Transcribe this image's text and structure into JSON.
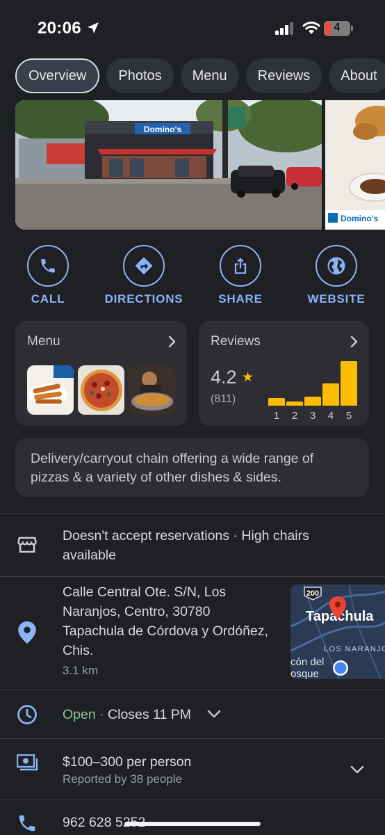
{
  "status_bar": {
    "time": "20:06",
    "battery_level": "4"
  },
  "tabs": [
    {
      "label": "Overview",
      "active": true
    },
    {
      "label": "Photos",
      "active": false
    },
    {
      "label": "Menu",
      "active": false
    },
    {
      "label": "Reviews",
      "active": false
    },
    {
      "label": "About",
      "active": false
    }
  ],
  "photos": {
    "main_sign_text": "Domino's",
    "second_sign_text": "Domino's"
  },
  "actions": {
    "call": "CALL",
    "directions": "DIRECTIONS",
    "share": "SHARE",
    "website": "WEBSITE"
  },
  "menu_card": {
    "title": "Menu"
  },
  "reviews_card": {
    "title": "Reviews",
    "rating": "4.2",
    "count": "(811)",
    "histogram_labels": [
      "1",
      "2",
      "3",
      "4",
      "5"
    ],
    "histogram_fractions": [
      0.17,
      0.09,
      0.2,
      0.5,
      1.0
    ]
  },
  "description": "Delivery/carryout chain offering a wide range of pizzas & a variety of other dishes & sides.",
  "info": {
    "amenities": "Doesn't accept reservations · High chairs available",
    "address": "Calle Central Ote. S/N, Los Naranjos, Centro, 30780 Tapachula de Córdova y Ordóñez, Chis.",
    "distance": "3.1 km",
    "map_city": "Tapachula",
    "map_highway": "200",
    "map_area": "LOS NARANJO",
    "map_partial": "cón del osque",
    "hours_status": "Open",
    "hours_separator": "·",
    "hours_close": "Closes 11 PM",
    "price": "$100–300 per person",
    "price_reported": "Reported by 38 people",
    "phone": "962 628 5252"
  },
  "colors": {
    "accent_blue": "#8ab4f8",
    "star_yellow": "#fbbc04",
    "open_green": "#81c995",
    "pin_red": "#ea4335",
    "background": "#1f2023"
  }
}
